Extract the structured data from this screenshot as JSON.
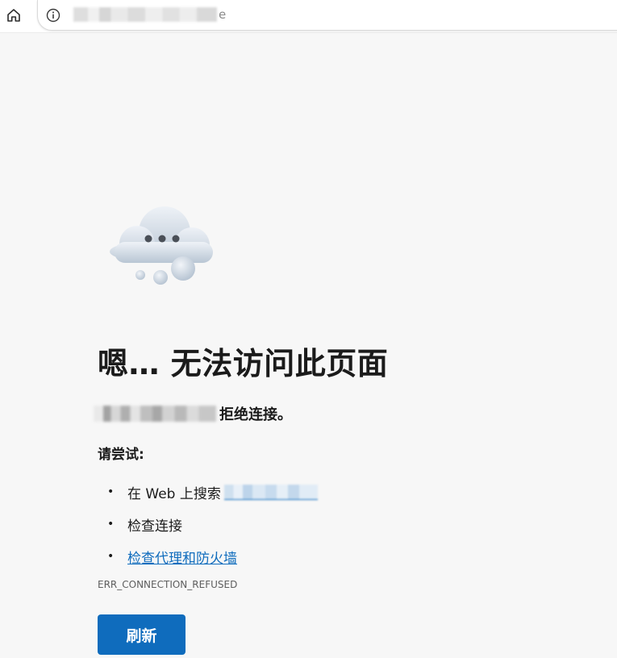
{
  "toolbar": {
    "home_icon": "home-icon",
    "info_icon": "info-icon",
    "url_visible_suffix": "e"
  },
  "error_page": {
    "illustration": "cloud-dots-icon",
    "title": "嗯… 无法访问此页面",
    "message": "拒绝连接。",
    "try_label": "请尝试:",
    "suggestions": [
      {
        "text": "在 Web 上搜索"
      },
      {
        "text": "检查连接"
      },
      {
        "text": "检查代理和防火墙"
      }
    ],
    "error_code": "ERR_CONNECTION_REFUSED",
    "reload_label": "刷新"
  },
  "colors": {
    "accent": "#0f6cbd",
    "page_background": "#f7f7f7"
  }
}
